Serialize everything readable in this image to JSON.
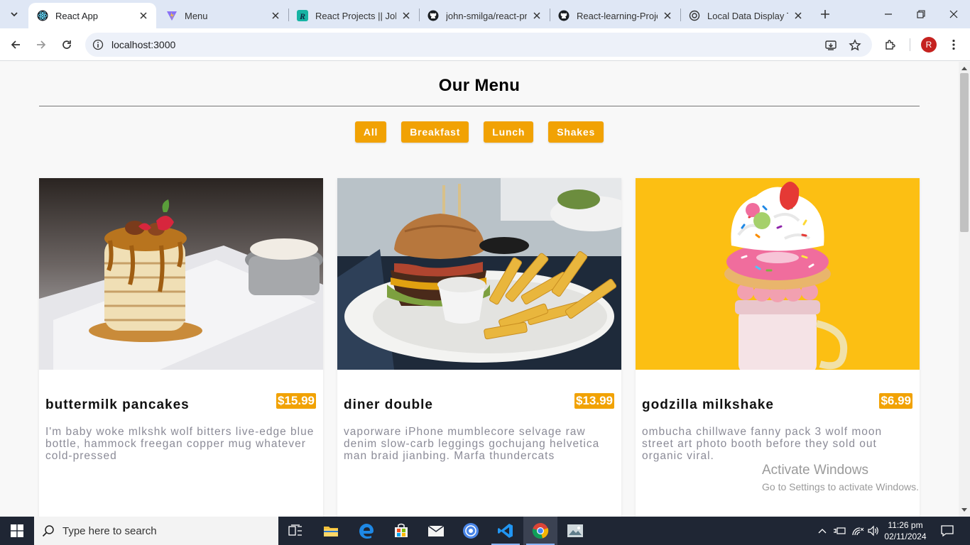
{
  "browser": {
    "tabs": [
      {
        "title": "React App",
        "active": true,
        "favicon": "react-icon"
      },
      {
        "title": "Menu",
        "active": false,
        "favicon": "vite-icon"
      },
      {
        "title": "React Projects || John",
        "active": false,
        "favicon": "r-logo-icon"
      },
      {
        "title": "john-smilga/react-pr",
        "active": false,
        "favicon": "github-icon"
      },
      {
        "title": "React-learning-Projec",
        "active": false,
        "favicon": "github-icon"
      },
      {
        "title": "Local Data Display To",
        "active": false,
        "favicon": "chatgpt-icon"
      }
    ],
    "url": "localhost:3000",
    "profile_initial": "R"
  },
  "page": {
    "title": "Our Menu",
    "filters": [
      "All",
      "Breakfast",
      "Lunch",
      "Shakes"
    ],
    "items": [
      {
        "name": "buttermilk pancakes",
        "price": "$15.99",
        "desc": "I'm baby woke mlkshk wolf bitters live-edge blue bottle, hammock freegan copper mug whatever cold-pressed",
        "image": "pancakes-photo"
      },
      {
        "name": "diner double",
        "price": "$13.99",
        "desc": "vaporware iPhone mumblecore selvage raw denim slow-carb leggings gochujang helvetica man braid jianbing. Marfa thundercats",
        "image": "burger-photo"
      },
      {
        "name": "godzilla milkshake",
        "price": "$6.99",
        "desc": "ombucha chillwave fanny pack 3 wolf moon street art photo booth before they sold out organic viral.",
        "image": "milkshake-photo"
      }
    ]
  },
  "watermark": {
    "line1": "Activate Windows",
    "line2": "Go to Settings to activate Windows."
  },
  "taskbar": {
    "search_placeholder": "Type here to search",
    "time": "11:26 pm",
    "date": "02/11/2024"
  },
  "colors": {
    "accent": "#f1a204",
    "tabstrip": "#dfe7f5",
    "taskbar": "#1f2634"
  }
}
